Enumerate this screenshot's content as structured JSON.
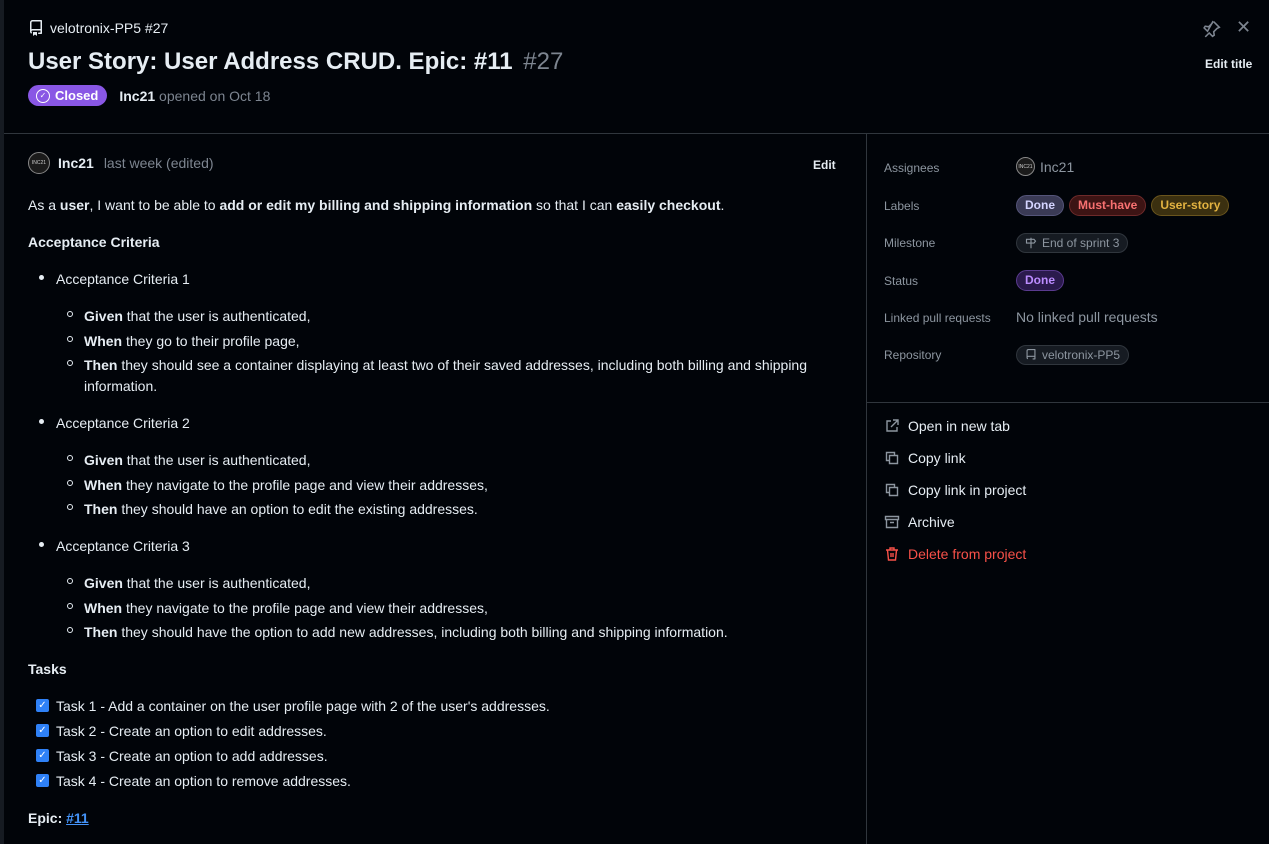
{
  "header": {
    "repo_ref": "velotronix-PP5 #27",
    "title": "User Story: User Address CRUD. Epic: #11",
    "number": "#27",
    "state": "Closed",
    "author": "Inc21",
    "opened_text": "opened on Oct 18",
    "edit_title_label": "Edit title"
  },
  "comment": {
    "author": "Inc21",
    "meta": "last week (edited)",
    "edit_label": "Edit",
    "intro": {
      "p1": "As a ",
      "b1": "user",
      "p2": ", I want to be able to ",
      "b2": "add or edit my billing and shipping information",
      "p3": " so that I can ",
      "b3": "easily checkout",
      "p4": "."
    },
    "ac_heading": "Acceptance Criteria",
    "criteria": [
      {
        "title": "Acceptance Criteria 1",
        "items": [
          {
            "kw": "Given",
            "text": " that the user is authenticated,"
          },
          {
            "kw": "When",
            "text": " they go to their profile page,"
          },
          {
            "kw": "Then",
            "text": " they should see a container displaying at least two of their saved addresses, including both billing and shipping"
          },
          {
            "kw": "",
            "text": "information."
          }
        ]
      },
      {
        "title": "Acceptance Criteria 2",
        "items": [
          {
            "kw": "Given",
            "text": " that the user is authenticated,"
          },
          {
            "kw": "When",
            "text": " they navigate to the profile page and view their addresses,"
          },
          {
            "kw": "Then",
            "text": " they should have an option to edit the existing addresses."
          }
        ]
      },
      {
        "title": "Acceptance Criteria 3",
        "items": [
          {
            "kw": "Given",
            "text": " that the user is authenticated,"
          },
          {
            "kw": "When",
            "text": " they navigate to the profile page and view their addresses,"
          },
          {
            "kw": "Then",
            "text": " they should have the option to add new addresses, including both billing and shipping information."
          }
        ]
      }
    ],
    "tasks_heading": "Tasks",
    "tasks": [
      "Task 1 - Add a container on the user profile page with 2 of the user's addresses.",
      "Task 2 - Create an option to edit addresses.",
      "Task 3 - Create an option to add addresses.",
      "Task 4 - Create an option to remove addresses."
    ],
    "epic_label": "Epic:",
    "epic_link": "#11"
  },
  "sidebar": {
    "assignees_label": "Assignees",
    "assignee": "Inc21",
    "labels_label": "Labels",
    "labels": [
      "Done",
      "Must-have",
      "User-story"
    ],
    "milestone_label": "Milestone",
    "milestone": "End of sprint 3",
    "status_label": "Status",
    "status": "Done",
    "linked_label": "Linked pull requests",
    "linked_value": "No linked pull requests",
    "repository_label": "Repository",
    "repository": "velotronix-PP5",
    "actions": {
      "open_new_tab": "Open in new tab",
      "copy_link": "Copy link",
      "copy_link_project": "Copy link in project",
      "archive": "Archive",
      "delete": "Delete from project"
    }
  },
  "colors": {
    "closed_badge": "#8957e5",
    "link": "#4493f8",
    "danger": "#f85149"
  }
}
